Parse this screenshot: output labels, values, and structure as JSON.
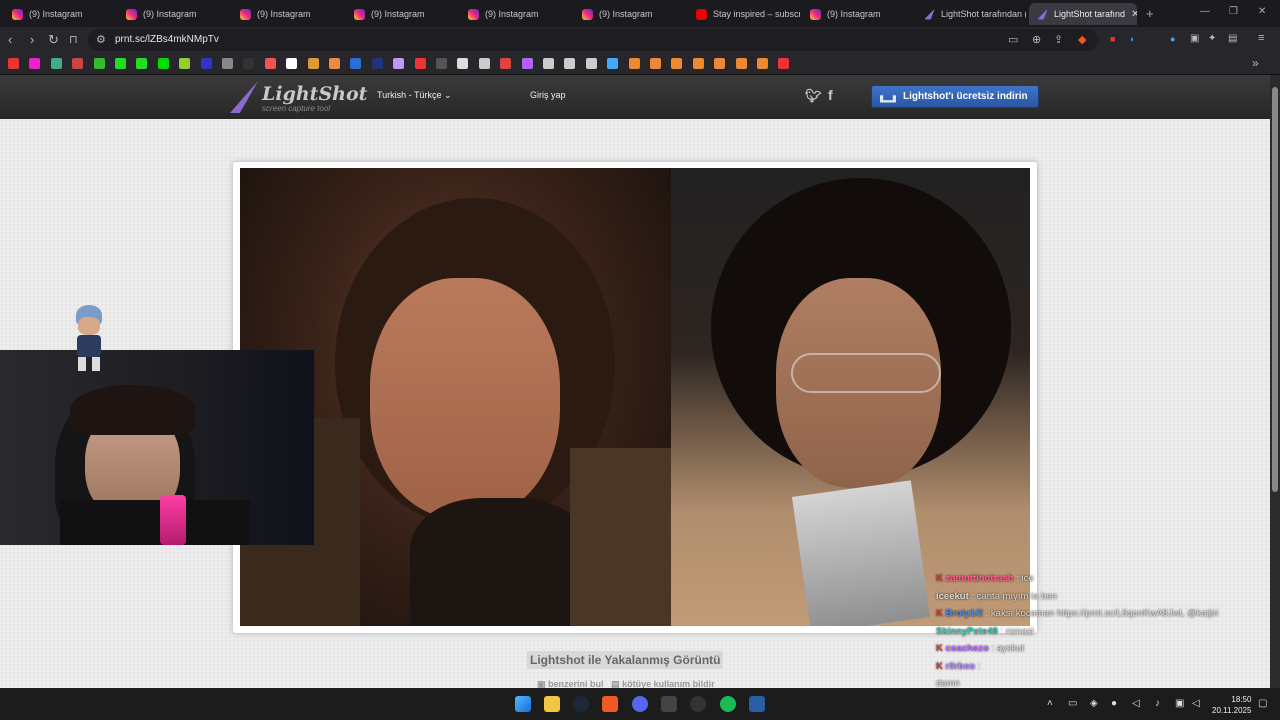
{
  "browser": {
    "tabs": [
      {
        "title": "(9) Instagram",
        "icon": "instagram-icon",
        "active": false
      },
      {
        "title": "(9) Instagram",
        "icon": "instagram-icon",
        "active": false
      },
      {
        "title": "(9) Instagram",
        "icon": "instagram-icon",
        "active": false
      },
      {
        "title": "(9) Instagram",
        "icon": "instagram-icon",
        "active": false
      },
      {
        "title": "(9) Instagram",
        "icon": "instagram-icon",
        "active": false
      },
      {
        "title": "(9) Instagram",
        "icon": "instagram-icon",
        "active": false
      },
      {
        "title": "Stay inspired – subscrib",
        "icon": "youtube-icon",
        "active": false
      },
      {
        "title": "(9) Instagram",
        "icon": "instagram-icon",
        "active": false
      },
      {
        "title": "LightShot tarafından (",
        "icon": "lightshot-icon",
        "active": false
      },
      {
        "title": "LightShot tarafınd",
        "icon": "lightshot-icon",
        "active": true
      }
    ],
    "close_tab_glyph": "✕",
    "new_tab_glyph": "+",
    "url": "prnt.sc/lZBs4mkNMpTv",
    "accent_color": "#3a3a42"
  },
  "lightshot": {
    "logo_text": "LightShot",
    "logo_subtext": "screen capture tool",
    "language": "Turkish - Türkçe",
    "login": "Giriş yap",
    "download_button": "Lightshot'ı ücretsiz indirin",
    "caption": "Lightshot ile Yakalanmış Görüntü",
    "find_similar": "benzerini bul",
    "report_abuse": "kötüye kullanım bildir",
    "brand_color": "#2a56a3"
  },
  "chat": {
    "messages": [
      {
        "user": "zamuttinotrash",
        "badge": "K",
        "text": "ice",
        "color": "#ff5c8a"
      },
      {
        "user": "iceekut",
        "badge": "",
        "text": "çanta mıyım la ben",
        "color": "#dddddd"
      },
      {
        "user": "Broly1/2",
        "badge": "K",
        "text": "kaksı kocaman https://prnt.sc/L6qonKwA8JwL @kaijiri",
        "color": "#3b8bff"
      },
      {
        "user": "SkinnyPete48",
        "badge": "",
        "text": "rsmasi",
        "color": "#37c9a0"
      },
      {
        "user": "coachezo",
        "badge": "K",
        "text": "ayskut",
        "color": "#b66bff"
      },
      {
        "user": "r0rbeo",
        "badge": "K",
        "text": "",
        "color": "#b48cff"
      },
      {
        "user": "",
        "badge": "",
        "text": "damn",
        "color": "#dddddd"
      }
    ]
  },
  "taskbar": {
    "time": "18:50",
    "date": "20.11.2025"
  }
}
